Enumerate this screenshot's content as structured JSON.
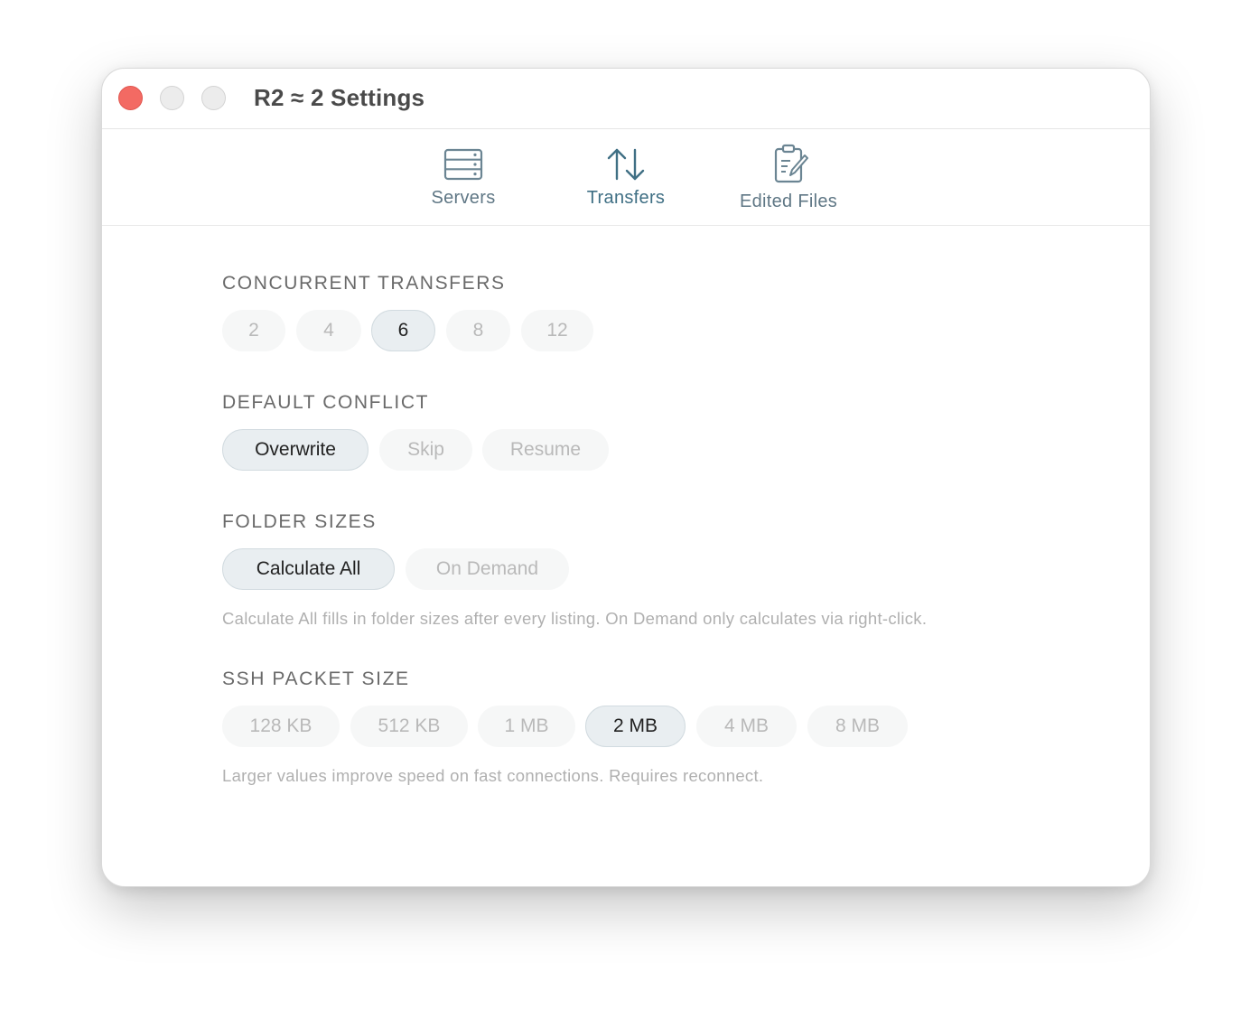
{
  "window": {
    "title": "R2 ≈ 2 Settings"
  },
  "toolbar": {
    "tabs": [
      {
        "label": "Servers",
        "icon": "server-icon"
      },
      {
        "label": "Transfers",
        "icon": "transfer-arrows-icon",
        "active": true
      },
      {
        "label": "Edited Files",
        "icon": "clipboard-edit-icon"
      }
    ]
  },
  "settings": {
    "concurrent_transfers": {
      "title": "CONCURRENT TRANSFERS",
      "options": [
        "2",
        "4",
        "6",
        "8",
        "12"
      ],
      "selected": "6"
    },
    "default_conflict": {
      "title": "DEFAULT CONFLICT",
      "options": [
        "Overwrite",
        "Skip",
        "Resume"
      ],
      "selected": "Overwrite"
    },
    "folder_sizes": {
      "title": "FOLDER SIZES",
      "options": [
        "Calculate All",
        "On Demand"
      ],
      "selected": "Calculate All",
      "hint": "Calculate All fills in folder sizes after every listing. On Demand only calculates via right-click."
    },
    "ssh_packet_size": {
      "title": "SSH PACKET SIZE",
      "options": [
        "128 KB",
        "512 KB",
        "1 MB",
        "2 MB",
        "4 MB",
        "8 MB"
      ],
      "selected": "2 MB",
      "hint": "Larger values improve speed on fast connections. Requires reconnect."
    }
  },
  "colors": {
    "close": "#f36a63",
    "accent": "#3f6f84",
    "selected_pill": "#e9eef1"
  }
}
